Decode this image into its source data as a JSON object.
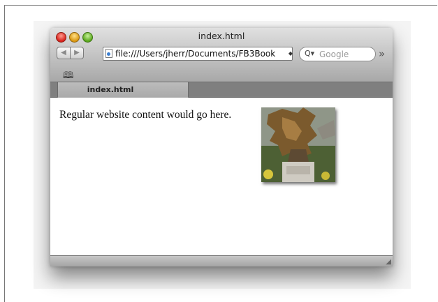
{
  "window": {
    "title": "index.html"
  },
  "toolbar": {
    "back_icon": "◀",
    "forward_icon": "▶",
    "address_value": "file:///Users/jherr/Documents/FB3Book",
    "address_stepper_icon": "◆",
    "search_placeholder": "Google",
    "search_icon": "Q▾",
    "overflow_icon": "»"
  },
  "bookmarks": {
    "icon": "🕮"
  },
  "tabs": [
    {
      "label": "index.html"
    }
  ],
  "content": {
    "text": "Regular website content would go here.",
    "image_alt": "statue photo"
  },
  "status": {
    "resize_icon": "◢"
  }
}
